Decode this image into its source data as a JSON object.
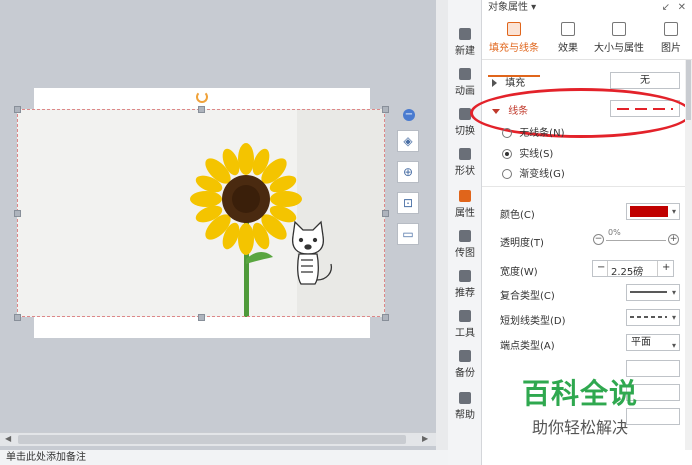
{
  "canvas": {
    "status_bar": "单击此处添加备注"
  },
  "vertical_tabs": [
    {
      "label": "新建",
      "icon": "new-icon"
    },
    {
      "label": "动画",
      "icon": "animation-icon"
    },
    {
      "label": "切换",
      "icon": "transition-icon"
    },
    {
      "label": "形状",
      "icon": "shape-icon"
    },
    {
      "label": "属性",
      "icon": "property-icon",
      "active": true
    },
    {
      "label": "传图",
      "icon": "upload-image-icon"
    },
    {
      "label": "推荐",
      "icon": "recommend-icon"
    },
    {
      "label": "工具",
      "icon": "toolbox-icon"
    },
    {
      "label": "备份",
      "icon": "backup-icon"
    },
    {
      "label": "帮助",
      "icon": "help-icon"
    }
  ],
  "panel": {
    "title": "对象属性 ▾",
    "tabs": [
      {
        "label": "填充与线条",
        "active": true
      },
      {
        "label": "效果"
      },
      {
        "label": "大小与属性"
      },
      {
        "label": "图片"
      }
    ],
    "fill": {
      "label": "填充",
      "value": "无"
    },
    "line": {
      "label": "线条"
    },
    "line_options": [
      {
        "label": "无线条(N)",
        "selected": false
      },
      {
        "label": "实线(S)",
        "selected": true
      },
      {
        "label": "渐变线(G)",
        "selected": false
      }
    ],
    "color": {
      "label": "颜色(C)",
      "value_color": "#c00000"
    },
    "transparency": {
      "label": "透明度(T)",
      "value": "0%"
    },
    "width": {
      "label": "宽度(W)",
      "value": "2.25磅",
      "minus": "−",
      "plus": "+"
    },
    "compound": {
      "label": "复合类型(C)"
    },
    "dash": {
      "label": "短划线类型(D)"
    },
    "cap": {
      "label": "端点类型(A)",
      "value": "平面"
    }
  },
  "watermark": {
    "line1": "百科全说",
    "line2": "助你轻松解决"
  },
  "colors": {
    "accent": "#e0651b",
    "line_color": "#e3222a",
    "swatch": "#c00000"
  }
}
